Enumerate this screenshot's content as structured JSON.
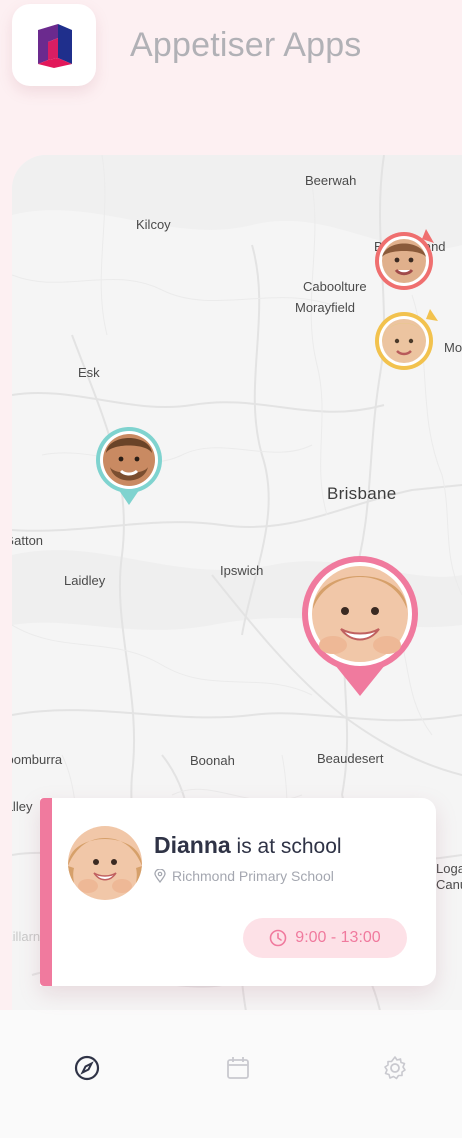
{
  "app": {
    "title": "Appetiser Apps",
    "icon": "appetiser-logo-icon",
    "brand_colors": [
      "#6b2a8e",
      "#e2185a",
      "#1f2f8c"
    ]
  },
  "map": {
    "labels": {
      "beerwah": "Beerwah",
      "kilcoy": "Kilcoy",
      "bribie": "Bribie Island",
      "caboolture": "Caboolture",
      "morayfield": "Morayfield",
      "moreton": "Moreton",
      "esk": "Esk",
      "brisbane": "Brisbane",
      "gatton": "Gatton",
      "laidley": "Laidley",
      "ipswich": "Ipswich",
      "boonah": "Boonah",
      "beaudesert": "Beaudesert",
      "coomburra": "Toomburra",
      "valley": "Valley",
      "killarney": "Killarney",
      "logan": "Logan",
      "canungra": "Canungra"
    },
    "markers": [
      {
        "id": "child-red",
        "color": "#ef6f6f"
      },
      {
        "id": "child-yellow",
        "color": "#f2c24e"
      },
      {
        "id": "adult-teal",
        "color": "#7fd3cf"
      },
      {
        "id": "dianna",
        "color": "#f07a9e"
      }
    ]
  },
  "status_card": {
    "name": "Dianna",
    "status": " is at school",
    "location": "Richmond Primary School",
    "time": "9:00 - 13:00",
    "accent_color": "#f07a9e"
  },
  "nav": {
    "items": [
      {
        "icon": "compass-icon",
        "active": true
      },
      {
        "icon": "calendar-icon",
        "active": false
      },
      {
        "icon": "gear-icon",
        "active": false
      }
    ]
  }
}
